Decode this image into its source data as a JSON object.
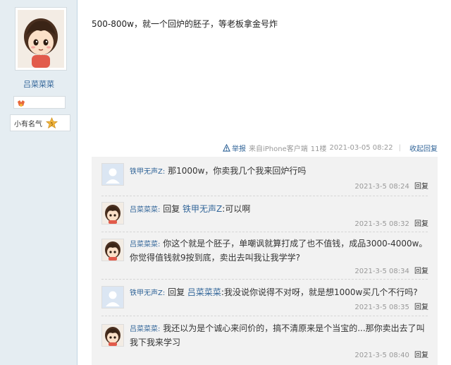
{
  "author": {
    "name": "吕菜菜菜",
    "rank_label": "小有名气",
    "rank_level": "5"
  },
  "post": {
    "content": "500-800w，就一个回炉的胚子，等老板拿金号炸",
    "report_label": "举报",
    "source": "来自iPhone客户端",
    "floor": "11楼",
    "timestamp": "2021-03-05 08:22",
    "collapse_label": "收起回复"
  },
  "replies": [
    {
      "user": "铁甲无声Z:",
      "prefix": "",
      "mention": "",
      "text": "那1000w，你卖我几个我来回炉行吗",
      "time": "2021-3-5 08:24",
      "action": "回复"
    },
    {
      "user": "吕菜菜菜:",
      "prefix": "回复",
      "mention": "铁甲无声Z",
      "text": ":可以啊",
      "time": "2021-3-5 08:32",
      "action": "回复"
    },
    {
      "user": "吕菜菜菜:",
      "prefix": "",
      "mention": "",
      "text": "你这个就是个胚子，单嘲讽就算打成了也不值钱，成品3000-4000w。你觉得值钱就9按到底，卖出去叫我让我学学?",
      "time": "2021-3-5 08:34",
      "action": "回复"
    },
    {
      "user": "铁甲无声Z:",
      "prefix": "回复",
      "mention": "吕菜菜菜",
      "text": ":我没说你说得不对呀，就是想1000w买几个不行吗?",
      "time": "2021-3-5 08:35",
      "action": "回复"
    },
    {
      "user": "吕菜菜菜:",
      "prefix": "",
      "mention": "",
      "text": "我还以为是个诚心来问价的，搞不清原来是个当宝的...那你卖出去了叫我下我来学习",
      "time": "2021-3-5 08:40",
      "action": "回复"
    }
  ]
}
